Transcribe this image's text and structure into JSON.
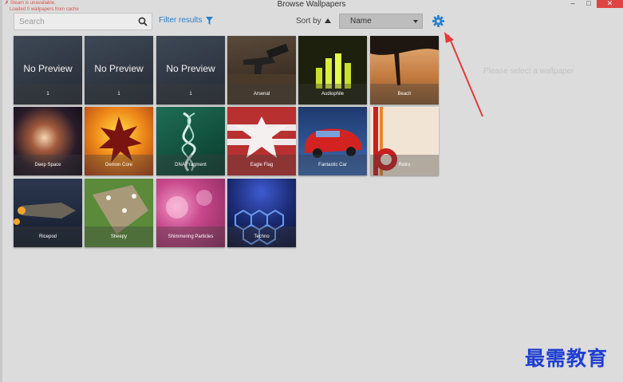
{
  "window": {
    "title": "Browse Wallpapers",
    "min_glyph": "–",
    "max_glyph": "□",
    "close_glyph": "✕"
  },
  "status": {
    "line1": "Steam is unavailable.",
    "line2": "Loaded 0 wallpapers from cache"
  },
  "toolbar": {
    "search_placeholder": "Search",
    "filter_label": "Filter results",
    "sort_label": "Sort by",
    "sort_value": "Name"
  },
  "details": {
    "empty_text": "Please select a wallpaper"
  },
  "wallpapers": [
    {
      "label": "1",
      "preview_text": "No Preview"
    },
    {
      "label": "1",
      "preview_text": "No Preview"
    },
    {
      "label": "1",
      "preview_text": "No Preview"
    },
    {
      "label": "Arsenal"
    },
    {
      "label": "Audiophile"
    },
    {
      "label": "Beach"
    },
    {
      "label": "Deep Space"
    },
    {
      "label": "Demon Core"
    },
    {
      "label": "DNA Fragment"
    },
    {
      "label": "Eagle Flag"
    },
    {
      "label": "Fantastic Car"
    },
    {
      "label": "Retro"
    },
    {
      "label": "Ricepod"
    },
    {
      "label": "Sheepy"
    },
    {
      "label": "Shimmering Particles"
    },
    {
      "label": "Techno"
    }
  ],
  "colors": {
    "accent": "#2a7fc9",
    "close": "#e04343",
    "annotation_arrow": "#e23a3a",
    "watermark": "#1f3fd1"
  },
  "watermark": {
    "text": "最需教育"
  }
}
